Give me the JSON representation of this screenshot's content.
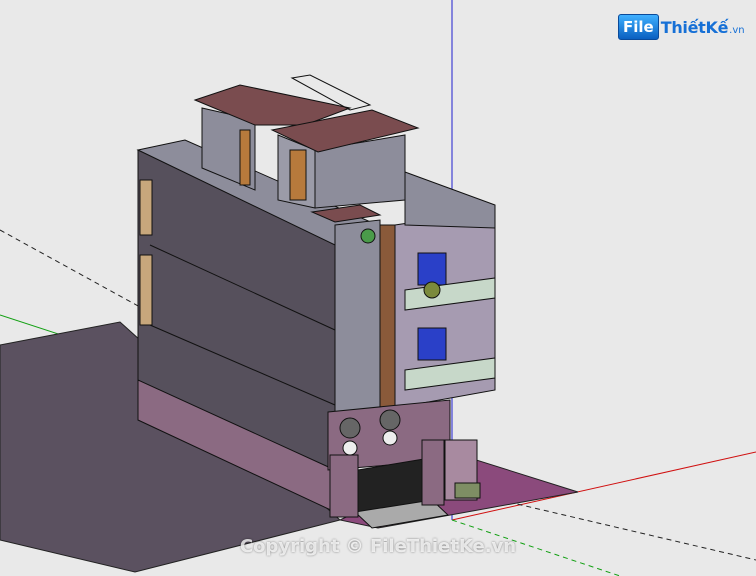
{
  "logo": {
    "badge": "File",
    "rest": "ThiếtKế",
    "tld": ".vn"
  },
  "watermark": {
    "text": "Copyright © FileThietKe.vn"
  },
  "colors": {
    "background": "#e9e9e9",
    "ground": "#5b5160",
    "roof": "#7a4c4f",
    "wall_dark": "#56505c",
    "wall_light": "#8d8d9b",
    "axis_red": "#d01010",
    "axis_green": "#12a012",
    "axis_blue": "#1818c0"
  }
}
